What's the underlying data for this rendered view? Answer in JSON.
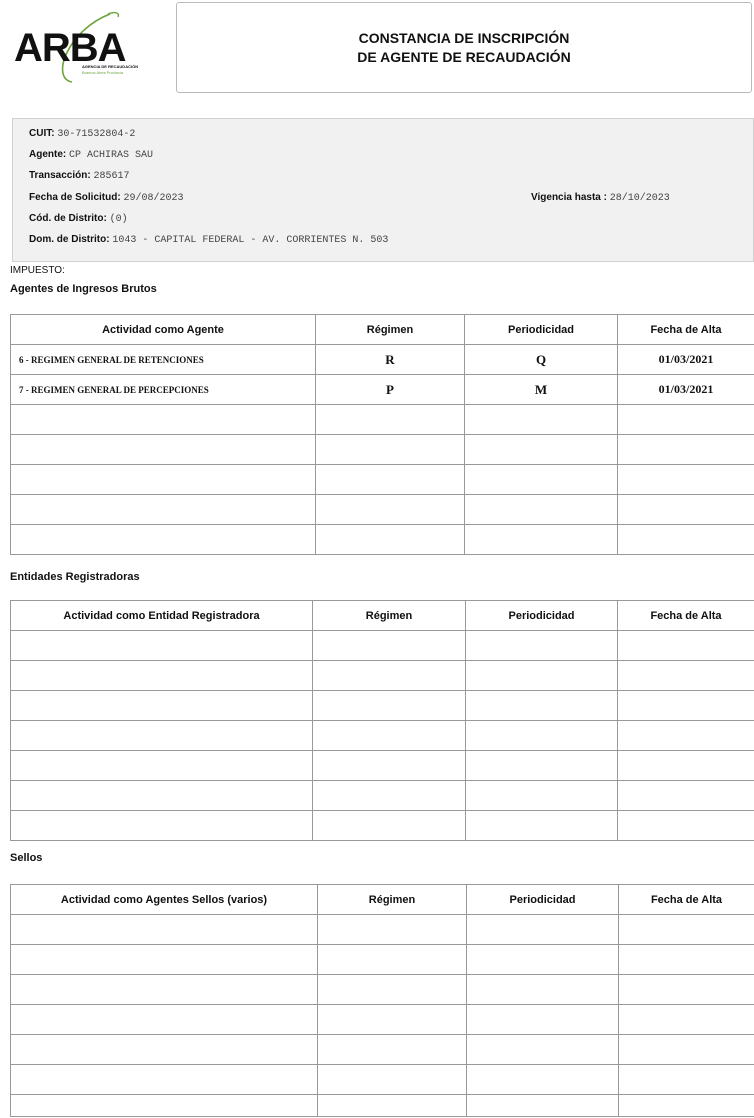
{
  "header": {
    "logo_text": "ARBA",
    "logo_sub1": "AGENCIA DE RECAUDACIÓN",
    "logo_sub2": "Buenos Aires Provincia",
    "title_line1": "CONSTANCIA DE INSCRIPCIÓN",
    "title_line2": "DE AGENTE DE RECAUDACIÓN"
  },
  "info": {
    "cuit_label": "CUIT:",
    "cuit_value": "30-71532804-2",
    "agente_label": "Agente:",
    "agente_value": "CP ACHIRAS SAU",
    "transaccion_label": "Transacción:",
    "transaccion_value": "285617",
    "fecha_label": "Fecha de Solicitud:",
    "fecha_value": "29/08/2023",
    "vigencia_label": "Vigencia hasta :",
    "vigencia_value": "28/10/2023",
    "distrito_label": "Cód. de Distrito:",
    "distrito_value": "(0)",
    "dom_label": "Dom. de Distrito:",
    "dom_value": "1043 - CAPITAL FEDERAL - AV. CORRIENTES N. 503"
  },
  "impuesto_label": "IMPUESTO:",
  "sections": {
    "ingresos": {
      "title": "Agentes de Ingresos Brutos",
      "headers": [
        "Actividad como Agente",
        "Régimen",
        "Periodicidad",
        "Fecha de Alta"
      ],
      "rows": [
        [
          "6 - REGIMEN GENERAL DE RETENCIONES",
          "R",
          "Q",
          "01/03/2021"
        ],
        [
          "7 - REGIMEN GENERAL DE PERCEPCIONES",
          "P",
          "M",
          "01/03/2021"
        ]
      ]
    },
    "entidades": {
      "title": "Entidades Registradoras",
      "headers": [
        "Actividad como Entidad Registradora",
        "Régimen",
        "Periodicidad",
        "Fecha de Alta"
      ]
    },
    "sellos": {
      "title": "Sellos",
      "headers": [
        "Actividad como Agentes Sellos (varios)",
        "Régimen",
        "Periodicidad",
        "Fecha de Alta"
      ]
    }
  }
}
